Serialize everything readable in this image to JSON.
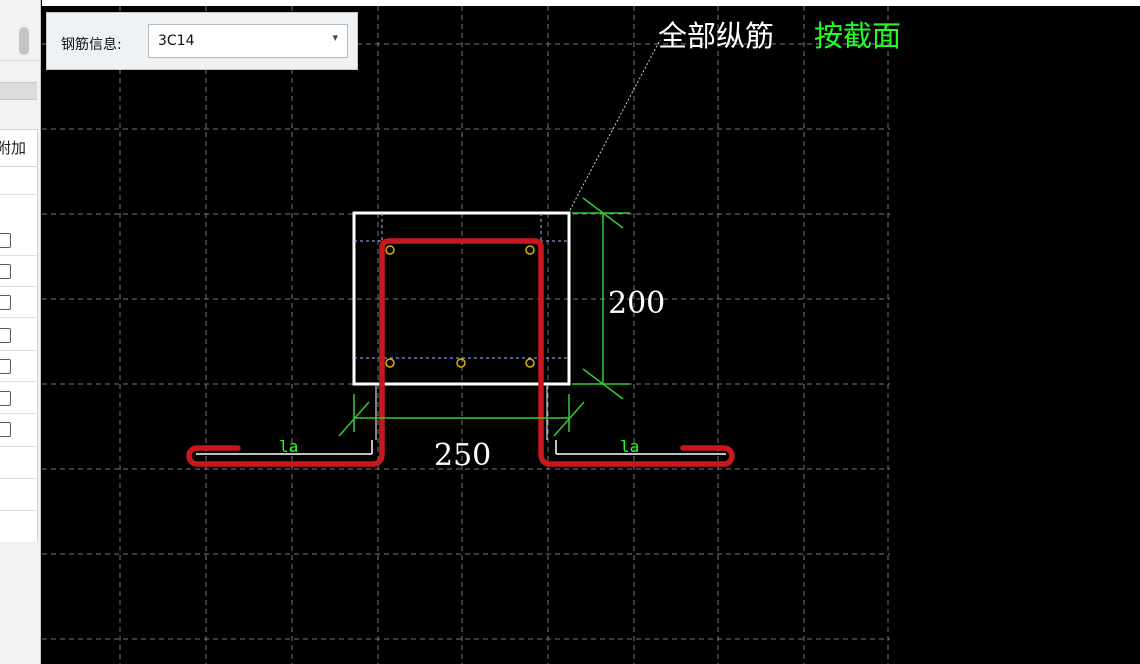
{
  "panel": {
    "column_header": "附加",
    "checkbox_count": 7
  },
  "toolbar": {
    "rebar_info_label": "钢筋信息:",
    "rebar_info_value": "3C14"
  },
  "drawing": {
    "callout_text": "全部纵筋",
    "callout_mode": "按截面",
    "height_dim": "200",
    "width_dim": "250",
    "anchor_left": "la",
    "anchor_right": "la",
    "colors": {
      "background": "#000000",
      "grid": "#8c8c8c",
      "section_outline": "#ffffff",
      "rebar": "#c8181e",
      "dimension": "#33cc33",
      "rebar_points": "#d9b400",
      "callout_mode": "#22ff22"
    }
  }
}
